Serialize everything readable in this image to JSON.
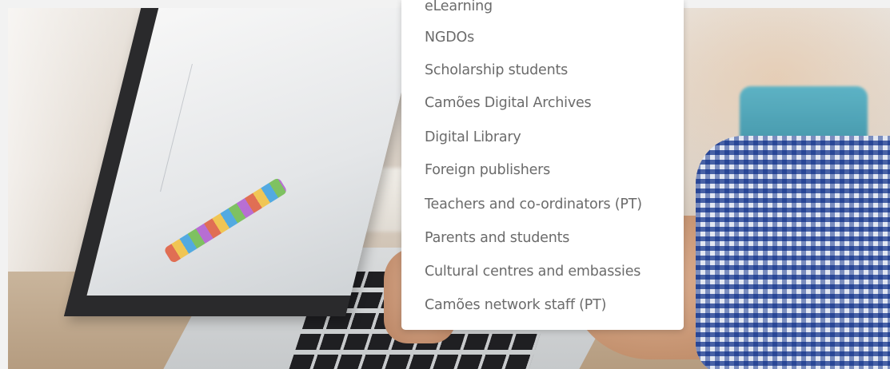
{
  "dropdown": {
    "items": [
      {
        "label": "eLearning"
      },
      {
        "label": "NGDOs"
      },
      {
        "label": "Scholarship students"
      },
      {
        "label": "Camões Digital Archives"
      },
      {
        "label": "Digital Library"
      },
      {
        "label": "Foreign publishers"
      },
      {
        "label": "Teachers and co-ordinators (PT)"
      },
      {
        "label": "Parents and students"
      },
      {
        "label": "Cultural centres and embassies"
      },
      {
        "label": "Camões network staff (PT)"
      }
    ]
  },
  "colors": {
    "menu_text": "#6b6b6b",
    "menu_background": "#ffffff",
    "page_background": "#f2f2f2"
  }
}
